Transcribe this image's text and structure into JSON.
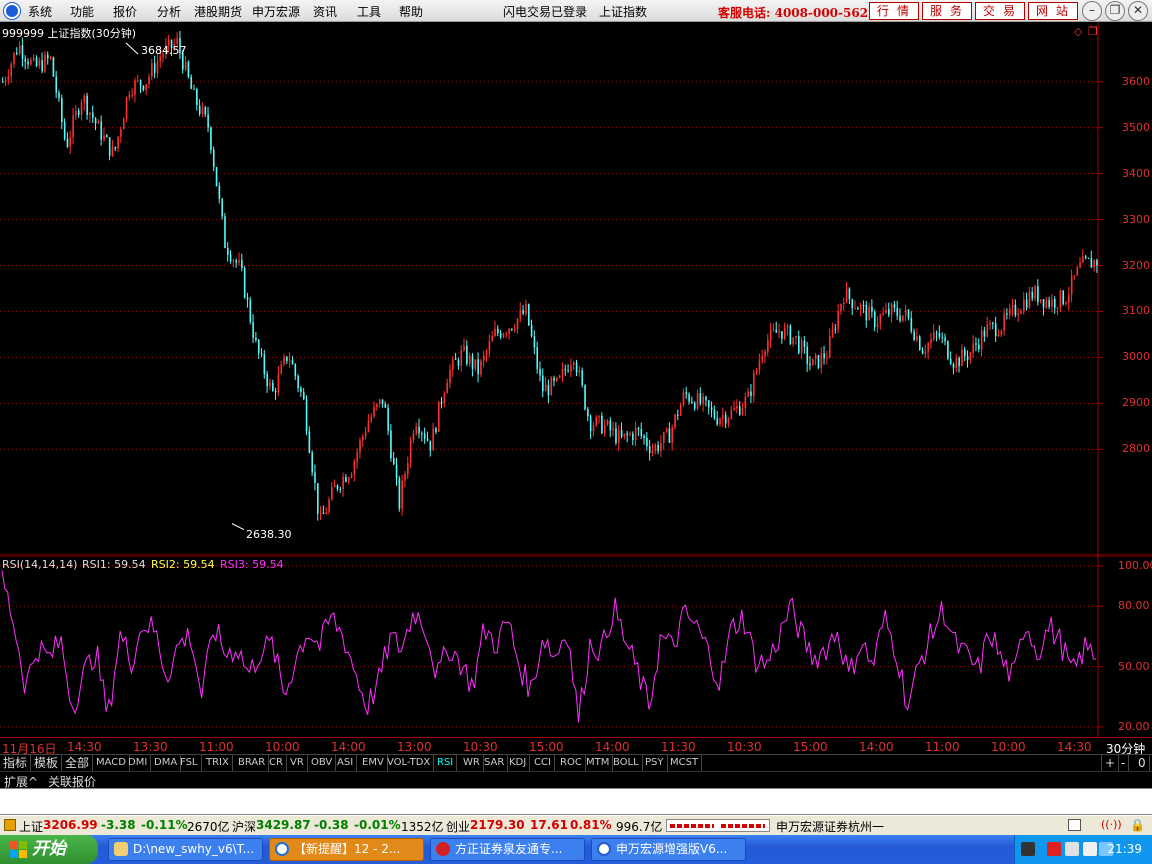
{
  "menu": {
    "items": [
      "系统",
      "功能",
      "报价",
      "分析",
      "港股期货",
      "申万宏源",
      "资讯",
      "工具",
      "帮助"
    ],
    "login_status": "闪电交易已登录",
    "current_index": "上证指数",
    "hotline": "客服电话: 4008-000-562",
    "tabs": [
      "行情",
      "服务",
      "交易",
      "网站"
    ]
  },
  "chart_data": [
    {
      "type": "candlestick",
      "title": "999999 上证指数(30分钟)",
      "y_ticks": [
        3600,
        3500,
        3400,
        3300,
        3200,
        3100,
        3000,
        2900,
        2800
      ],
      "ylim": [
        2570,
        3730
      ],
      "annotations": {
        "high": "3684.57",
        "low": "2638.30"
      },
      "close_path": [
        3600,
        3680,
        3630,
        3650,
        3460,
        3570,
        3500,
        3440,
        3590,
        3600,
        3660,
        3684.57,
        3570,
        3500,
        3250,
        3190,
        3020,
        2920,
        3010,
        2900,
        2638.3,
        2720,
        2760,
        2860,
        2910,
        2680,
        2870,
        2810,
        2960,
        3010,
        2970,
        3050,
        3070,
        3100,
        2930,
        2940,
        3010,
        2860,
        2850,
        2820,
        2840,
        2800,
        2830,
        2920,
        2900,
        2870,
        2880,
        2910,
        3030,
        3060,
        3040,
        2980,
        3010,
        3140,
        3110,
        3080,
        3100,
        3090,
        3020,
        3050,
        2990,
        3010,
        3060,
        3070,
        3110,
        3140,
        3120,
        3130,
        3200,
        3210
      ]
    },
    {
      "type": "line",
      "title": "RSI(14,14,14)",
      "series": [
        {
          "name": "RSI1",
          "value": "59.54"
        },
        {
          "name": "RSI2",
          "value": "59.54"
        },
        {
          "name": "RSI3",
          "value": "59.54"
        }
      ],
      "y_ticks": [
        "100.00",
        "80.00",
        "50.00",
        "20.00"
      ],
      "ylim": [
        15,
        105
      ],
      "values": [
        95,
        72,
        40,
        60,
        54,
        63,
        30,
        47,
        58,
        24,
        66,
        53,
        72,
        68,
        45,
        61,
        66,
        35,
        70,
        56,
        60,
        46,
        58,
        61,
        35,
        55,
        68,
        60,
        75,
        65,
        48,
        30,
        42,
        64,
        59,
        78,
        70,
        45,
        60,
        52,
        40,
        69,
        61,
        73,
        50,
        38,
        66,
        54,
        70,
        24,
        62,
        58,
        80,
        62,
        48,
        30,
        65,
        59,
        76,
        70,
        58,
        42,
        69,
        75,
        54,
        51,
        64,
        80,
        65,
        54,
        59,
        68,
        45,
        63,
        50,
        74,
        58,
        30,
        52,
        66,
        79,
        61,
        55,
        48,
        68,
        52,
        44,
        73,
        57,
        70,
        62,
        46,
        59,
        56
      ]
    }
  ],
  "time_axis": [
    "11月16日",
    "14:30",
    "13:30",
    "11:00",
    "10:00",
    "14:00",
    "13:00",
    "10:30",
    "15:00",
    "14:00",
    "11:30",
    "10:30",
    "15:00",
    "14:00",
    "11:00",
    "10:00",
    "14:30"
  ],
  "period_label": "30分钟",
  "indicator_tabs": [
    "指标",
    "模板",
    "全部",
    "MACD",
    "DMI",
    "DMA",
    "FSL",
    "TRIX",
    "BRAR",
    "CR",
    "VR",
    "OBV",
    "ASI",
    "EMV",
    "VOL-TDX",
    "RSI",
    "WR",
    "SAR",
    "KDJ",
    "CCI",
    "ROC",
    "MTM",
    "BOLL",
    "PSY",
    "MCST"
  ],
  "zoom_controls": [
    "+",
    "-",
    "0"
  ],
  "sub_tabs": [
    "扩展^",
    "关联报价"
  ],
  "status": {
    "sh_label": "上证",
    "sh_value": "3206.99",
    "sh_change": "-3.38",
    "sh_pct": "-0.11%",
    "sh_amount": "2670亿",
    "hs_label": "沪深",
    "hs_value": "3429.87",
    "hs_change": "-0.38",
    "hs_pct": "-0.01%",
    "hs_amount": "1352亿",
    "cy_label": "创业",
    "cy_value": "2179.30",
    "cy_change": "17.61",
    "cy_pct": "0.81%",
    "cy_amount": "996.7亿",
    "broker": "申万宏源证券杭州一"
  },
  "taskbar": {
    "start": "开始",
    "tasks": [
      {
        "label": "D:\\new_swhy_v6\\T...",
        "active": false
      },
      {
        "label": "【新提醒】12 - 2...",
        "active": true
      },
      {
        "label": "方正证券泉友通专...",
        "active": false
      },
      {
        "label": "申万宏源增强版V6...",
        "active": false
      }
    ],
    "clock": "21:39"
  },
  "colors": {
    "up": "#ff3030",
    "down": "#54fcfc",
    "rsi": "#ff30ff",
    "grid": "#a00000"
  }
}
